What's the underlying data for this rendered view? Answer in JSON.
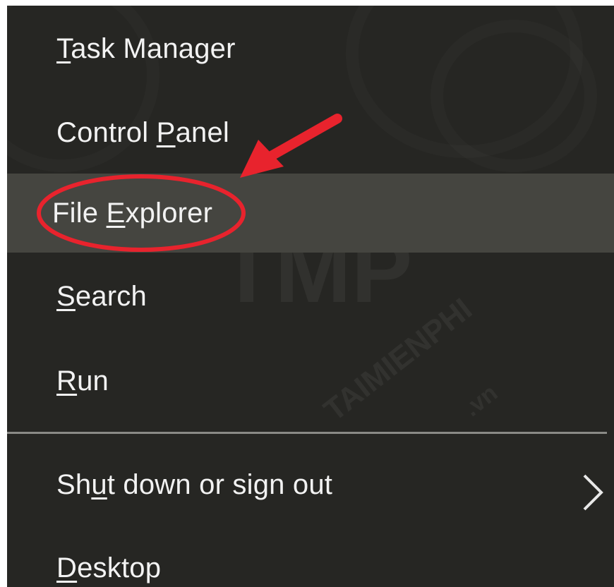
{
  "menu": {
    "items": [
      {
        "pre": "",
        "accel": "T",
        "post": "ask Manager"
      },
      {
        "pre": "Control ",
        "accel": "P",
        "post": "anel"
      },
      {
        "pre": "File ",
        "accel": "E",
        "post": "xplorer"
      },
      {
        "pre": "",
        "accel": "S",
        "post": "earch"
      },
      {
        "pre": "",
        "accel": "R",
        "post": "un"
      },
      {
        "pre": "Sh",
        "accel": "u",
        "post": "t down or sign out"
      },
      {
        "pre": "",
        "accel": "D",
        "post": "esktop"
      }
    ],
    "highlighted_item": "File Explorer",
    "submenu_icon": "chevron-right-icon"
  },
  "watermark": {
    "logo": "TMP",
    "text1": "TAIMIENPHI",
    "text2": ".vn"
  },
  "colors": {
    "menu_bg": "#262623",
    "highlight_bg": "#454540",
    "text": "#f2f2f2",
    "annotation": "#e8232d"
  }
}
